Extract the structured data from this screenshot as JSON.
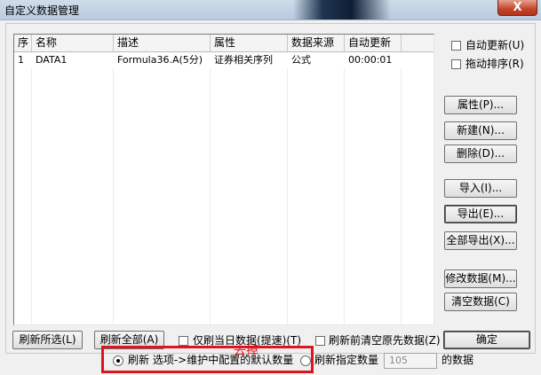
{
  "window": {
    "title": "自定义数据管理",
    "close_label": "X"
  },
  "table": {
    "columns": [
      "序",
      "名称",
      "描述",
      "属性",
      "数据来源",
      "自动更新"
    ],
    "rows": [
      [
        "1",
        "DATA1",
        "Formula36.A(5分)",
        "证券相关序列",
        "公式",
        "00:00:01"
      ]
    ]
  },
  "options": {
    "auto_update": "自动更新(U)",
    "drag_sort": "拖动排序(R)"
  },
  "side_buttons": {
    "properties": "属性(P)...",
    "new": "新建(N)...",
    "delete": "删除(D)...",
    "import": "导入(I)...",
    "export": "导出(E)...",
    "export_all": "全部导出(X)...",
    "modify_data": "修改数据(M)...",
    "clear_data": "清空数据(C)"
  },
  "bottom": {
    "refresh_selected": "刷新所选(L)",
    "refresh_all": "刷新全部(A)",
    "today_only": "仅刷当日数据(提速)(T)",
    "clear_before_refresh": "刷新前清空原先数据(Z)",
    "ok": "确定",
    "radio_default": "刷新 选项->维护中配置的默认数量",
    "radio_custom": "刷新指定数量",
    "count_value": "105",
    "count_suffix": "的数据",
    "annotation": "去掉"
  }
}
